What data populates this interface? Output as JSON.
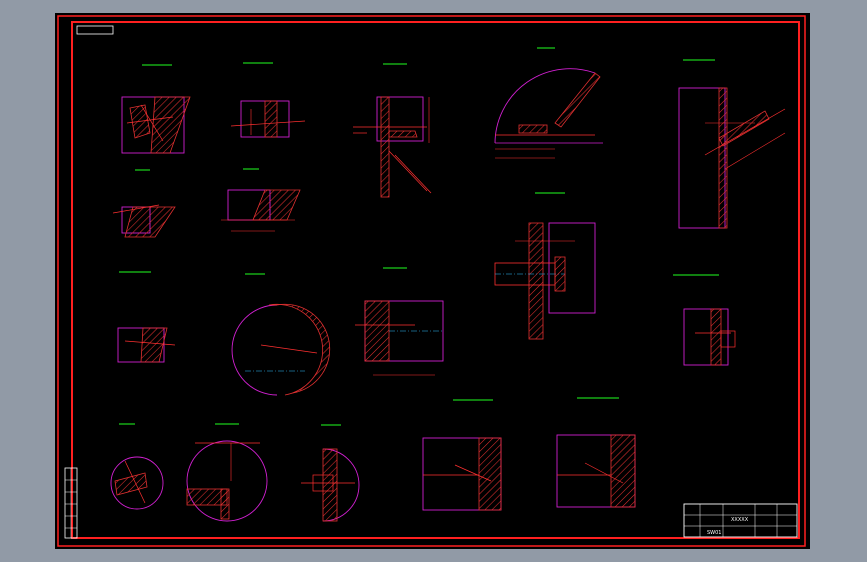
{
  "drawing": {
    "background_color": "#000000",
    "border_color": "#ff2020",
    "detail_outline_color": "#d020d0",
    "hatch_color": "#e03030",
    "dimension_color": "#ff3030",
    "centerline_color": "#30c0ff",
    "annotation_color": "#20ff20",
    "title_block_color": "#ffffff",
    "title_block": {
      "name": "XXXXX",
      "sheet_no": "SW01"
    }
  }
}
